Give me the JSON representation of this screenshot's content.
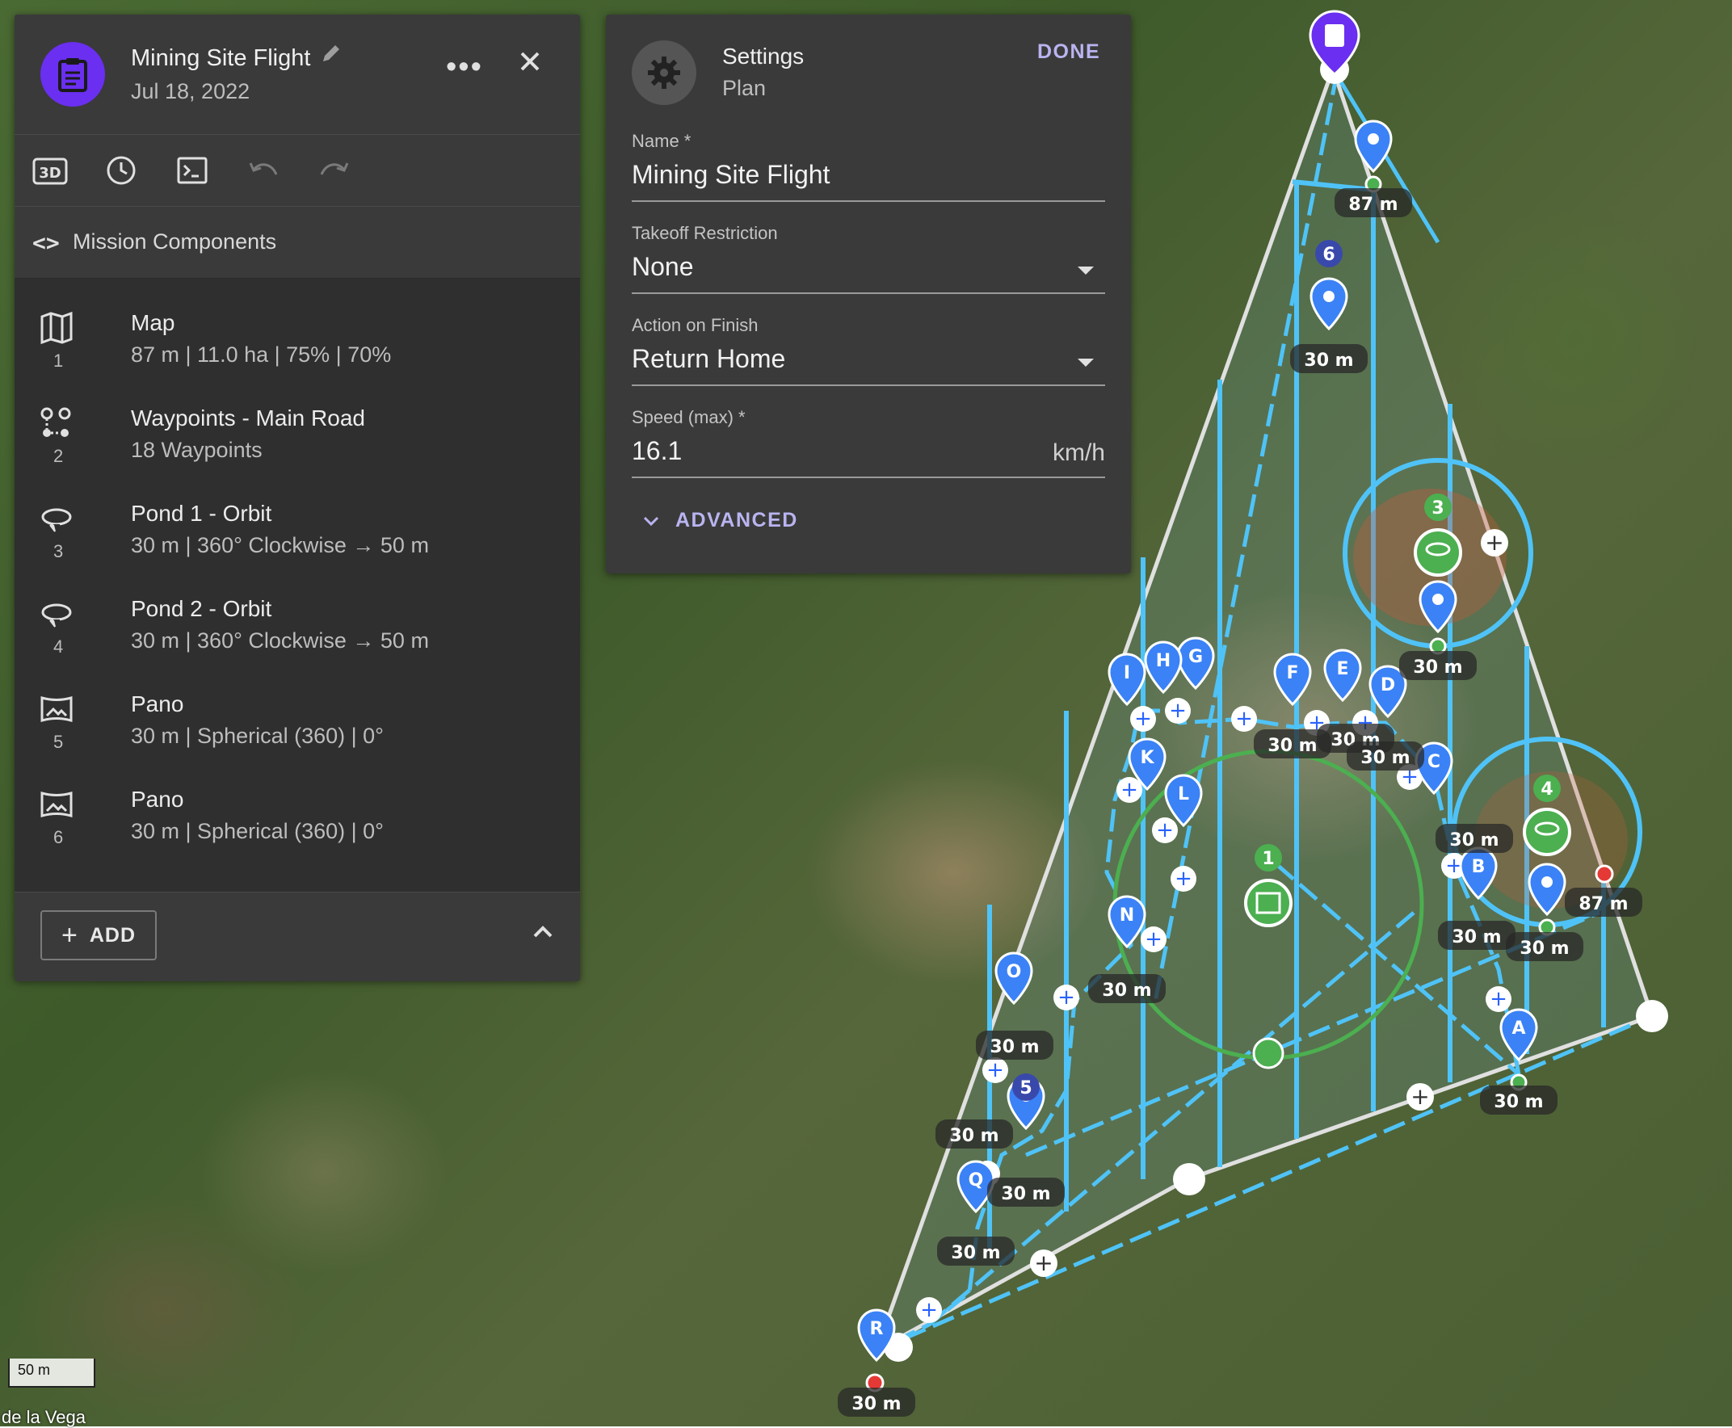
{
  "mission": {
    "title": "Mining Site Flight",
    "date": "Jul 18, 2022",
    "more_label": "•••",
    "section_label": "Mission Components",
    "components": [
      {
        "num": "1",
        "title": "Map",
        "subtitle": "87 m | 11.0 ha | 75% | 70%",
        "icon": "map-icon"
      },
      {
        "num": "2",
        "title": "Waypoints - Main Road",
        "subtitle": "18 Waypoints",
        "icon": "waypoints-icon"
      },
      {
        "num": "3",
        "title": "Pond 1 - Orbit",
        "subtitle": "30 m | 360° Clockwise → 50 m",
        "icon": "orbit-icon"
      },
      {
        "num": "4",
        "title": "Pond 2 - Orbit",
        "subtitle": "30 m | 360° Clockwise → 50 m",
        "icon": "orbit-icon"
      },
      {
        "num": "5",
        "title": "Pano",
        "subtitle": "30 m | Spherical (360) | 0°",
        "icon": "pano-icon"
      },
      {
        "num": "6",
        "title": "Pano",
        "subtitle": "30 m | Spherical (360) | 0°",
        "icon": "pano-icon"
      }
    ],
    "add_label": "ADD"
  },
  "settings": {
    "title": "Settings",
    "subtitle": "Plan",
    "done_label": "DONE",
    "name_label": "Name *",
    "name_value": "Mining Site Flight",
    "takeoff_label": "Takeoff Restriction",
    "takeoff_value": "None",
    "finish_label": "Action on Finish",
    "finish_value": "Return Home",
    "speed_label": "Speed (max) *",
    "speed_value": "16.1",
    "speed_unit": "km/h",
    "advanced_label": "ADVANCED"
  },
  "map": {
    "scale_label": "50 m",
    "place_label": "de la Vega",
    "colors": {
      "accent": "#3b82f6",
      "path": "#4fc3f7",
      "orbit": "#4caf50",
      "mission": "#6a2ff0"
    },
    "pins": [
      {
        "letter": "A"
      },
      {
        "letter": "B"
      },
      {
        "letter": "C"
      },
      {
        "letter": "D"
      },
      {
        "letter": "E"
      },
      {
        "letter": "F"
      },
      {
        "letter": "G"
      },
      {
        "letter": "H"
      },
      {
        "letter": "I"
      },
      {
        "letter": "K"
      },
      {
        "letter": "L"
      },
      {
        "letter": "N"
      },
      {
        "letter": "O"
      },
      {
        "letter": "Q"
      },
      {
        "letter": "R"
      }
    ],
    "badges": [
      "1",
      "3",
      "4",
      "5",
      "6"
    ],
    "altitude_labels": [
      {
        "text": "87 m"
      },
      {
        "text": "30 m"
      },
      {
        "text": "30 m"
      },
      {
        "text": "30 m"
      },
      {
        "text": "30 m"
      },
      {
        "text": "30 m"
      },
      {
        "text": "30 m"
      },
      {
        "text": "30 m"
      },
      {
        "text": "30 m"
      },
      {
        "text": "87 m"
      },
      {
        "text": "30 m"
      },
      {
        "text": "30 m"
      },
      {
        "text": "30 m"
      },
      {
        "text": "30 m"
      },
      {
        "text": "30 m"
      },
      {
        "text": "30 m"
      },
      {
        "text": "30 m"
      }
    ]
  }
}
